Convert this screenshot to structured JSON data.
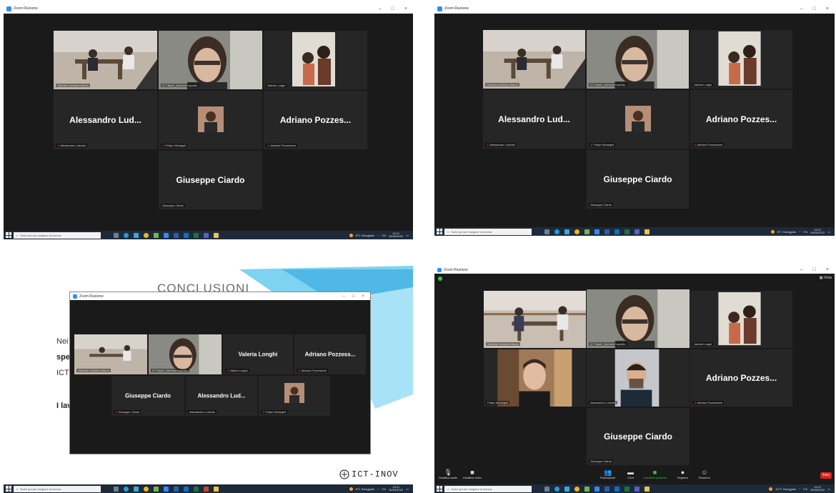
{
  "window_title": "Zoom Riunione",
  "colors": {
    "zoom_blue": "#2D8CFF",
    "active_speaker": "#9CCC3C",
    "muted_mic": "#e53935",
    "end_button": "#e0201e",
    "taskbar": "#1d2a3a"
  },
  "taskbar": {
    "search_placeholder": "Scrivi qui per eseguire la ricerca",
    "weather_a": "8°C Soleggiato",
    "weather_b": "10°C Soleggiato",
    "lang": "ITA",
    "time": "10:11",
    "date": "05/05/2022",
    "icons": [
      "start-icon",
      "search-icon",
      "task-view-icon",
      "edge-icon",
      "photos-icon",
      "chrome-icon",
      "store-icon",
      "zoom-icon",
      "word-icon",
      "outlook-icon",
      "excel-icon",
      "teams-icon",
      "explorer-icon"
    ]
  },
  "top_left": {
    "tiles": [
      {
        "label": "Gabriele Umberto Mauro"
      },
      {
        "label": "ICT BasE_Michela Esposito"
      },
      {
        "label": "Valeria Longhi"
      },
      {
        "name": "Alessandro Lud...",
        "label": "Alessandro Ludovisi",
        "muted": true
      },
      {
        "label": "Felipe Micangeli",
        "muted": true
      },
      {
        "name": "Adriano Pozzes...",
        "label": "Adriano Pozzessere",
        "muted": true
      },
      {
        "name": "Giuseppe Ciardo",
        "label": "Giuseppe Ciardo"
      }
    ]
  },
  "top_right": {
    "tiles": [
      {
        "label": "Gabriele Umberto Mauro"
      },
      {
        "label": "ICT BasE_Michela Esposito"
      },
      {
        "label": "Valeria Longhi"
      },
      {
        "name": "Alessandro Lud...",
        "label": "Alessandro Ludovisi",
        "muted": true
      },
      {
        "label": "Felipe Micangeli",
        "muted": true
      },
      {
        "name": "Adriano Pozzes...",
        "label": "Adriano Pozzessere",
        "muted": true
      },
      {
        "name": "Giuseppe Ciardo",
        "label": "Giuseppe Ciardo"
      }
    ]
  },
  "bottom_left": {
    "slide_title": "CONCLUSIONI",
    "slide_frag": {
      "line1": "Nei",
      "line2": "spe",
      "line3": "ICT_",
      "line4": "I lav"
    },
    "logo_text": "ICT-INOV",
    "tiles": [
      {
        "label": "Gabriele Umberto Mauro"
      },
      {
        "label": "ICT BasE_Michela Esposito"
      },
      {
        "name": "Valeria Longhi",
        "label": "Valeria Longhi",
        "muted": true
      },
      {
        "name": "Adriano Pozzess...",
        "label": "Adriano Pozzessere",
        "muted": true
      },
      {
        "name": "Giuseppe Ciardo",
        "label": "Giuseppe Ciardo",
        "muted": true
      },
      {
        "name": "Alessandro Lud...",
        "label": "Alessandro Ludovisi"
      },
      {
        "label": "Felipe Micangeli",
        "muted": true
      }
    ]
  },
  "bottom_right": {
    "view_label": "Vista",
    "tiles": [
      {
        "label": "Gabriele Umberto Mauro"
      },
      {
        "label": "ICT BasE_Michela Esposito"
      },
      {
        "label": "Valeria Longhi"
      },
      {
        "label": "Felipe Micangeli"
      },
      {
        "label": "Alessandro Ludovisi"
      },
      {
        "name": "Adriano Pozzes...",
        "label": "Adriano Pozzessere",
        "muted": true
      },
      {
        "name": "Giuseppe Ciardo",
        "label": "Giuseppe Ciardo"
      }
    ],
    "toolbar": {
      "audio": "Disattiva audio",
      "video": "Disattiva video",
      "participants": "Partecipanti",
      "participants_count": "8",
      "chat": "Chat",
      "share": "Condividi schermo",
      "record": "Registra",
      "reactions": "Reazioni",
      "end": "Esci"
    }
  }
}
